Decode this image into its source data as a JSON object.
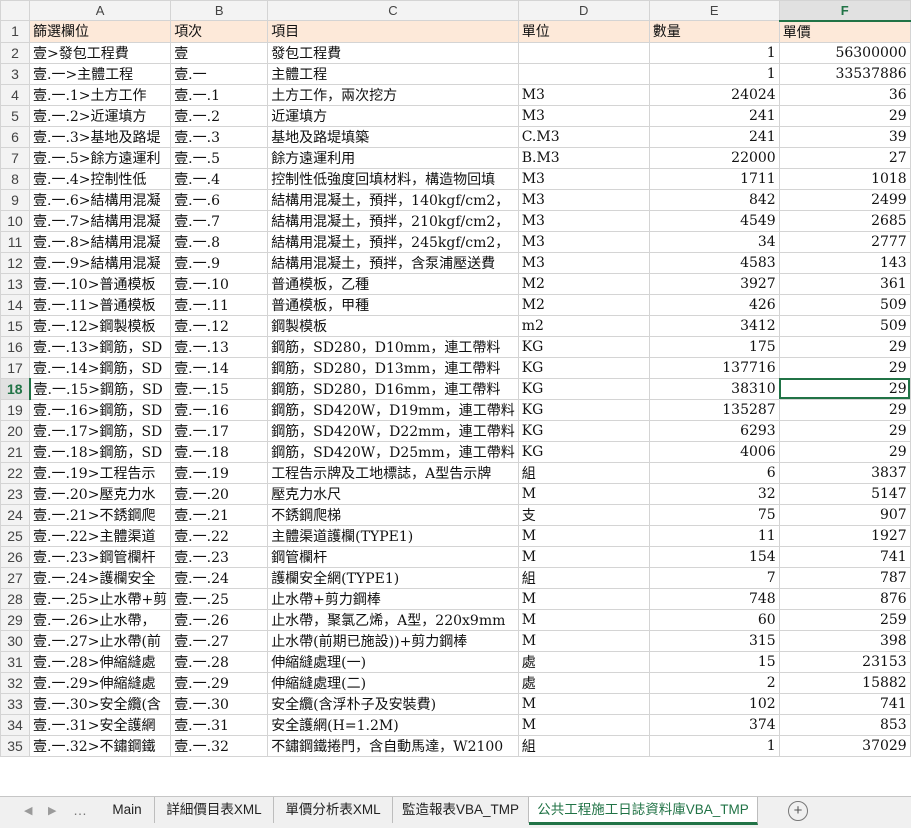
{
  "columns": [
    "A",
    "B",
    "C",
    "D",
    "E",
    "F"
  ],
  "rows": [
    {
      "n": "1",
      "a": "篩選欄位",
      "b": "項次",
      "c": "項目",
      "d": "單位",
      "e": "數量",
      "f": "單價"
    },
    {
      "n": "2",
      "a": "壹>發包工程費",
      "b": "壹",
      "c": "發包工程費",
      "d": "",
      "e": "1",
      "f": "56300000"
    },
    {
      "n": "3",
      "a": "壹.一>主體工程",
      "b": "壹.一",
      "c": "主體工程",
      "d": "",
      "e": "1",
      "f": "33537886"
    },
    {
      "n": "4",
      "a": "壹.一.1>土方工作",
      "b": "壹.一.1",
      "c": "土方工作，兩次挖方",
      "d": "M3",
      "e": "24024",
      "f": "36"
    },
    {
      "n": "5",
      "a": "壹.一.2>近運填方",
      "b": "壹.一.2",
      "c": "近運填方",
      "d": "M3",
      "e": "241",
      "f": "29"
    },
    {
      "n": "6",
      "a": "壹.一.3>基地及路堤",
      "b": "壹.一.3",
      "c": "基地及路堤填築",
      "d": "C.M3",
      "e": "241",
      "f": "39"
    },
    {
      "n": "7",
      "a": "壹.一.5>餘方遠運利",
      "b": "壹.一.5",
      "c": "餘方遠運利用",
      "d": "B.M3",
      "e": "22000",
      "f": "27"
    },
    {
      "n": "8",
      "a": "壹.一.4>控制性低",
      "b": "壹.一.4",
      "c": "控制性低強度回填材料，構造物回填",
      "d": "M3",
      "e": "1711",
      "f": "1018"
    },
    {
      "n": "9",
      "a": "壹.一.6>結構用混凝",
      "b": "壹.一.6",
      "c": "結構用混凝土，預拌，140kgf/cm2，",
      "d": "M3",
      "e": "842",
      "f": "2499"
    },
    {
      "n": "10",
      "a": "壹.一.7>結構用混凝",
      "b": "壹.一.7",
      "c": "結構用混凝土，預拌，210kgf/cm2，",
      "d": "M3",
      "e": "4549",
      "f": "2685"
    },
    {
      "n": "11",
      "a": "壹.一.8>結構用混凝",
      "b": "壹.一.8",
      "c": "結構用混凝土，預拌，245kgf/cm2，",
      "d": "M3",
      "e": "34",
      "f": "2777"
    },
    {
      "n": "12",
      "a": "壹.一.9>結構用混凝",
      "b": "壹.一.9",
      "c": "結構用混凝土，預拌，含泵浦壓送費",
      "d": "M3",
      "e": "4583",
      "f": "143"
    },
    {
      "n": "13",
      "a": "壹.一.10>普通模板",
      "b": "壹.一.10",
      "c": "普通模板，乙種",
      "d": "M2",
      "e": "3927",
      "f": "361"
    },
    {
      "n": "14",
      "a": "壹.一.11>普通模板",
      "b": "壹.一.11",
      "c": "普通模板，甲種",
      "d": "M2",
      "e": "426",
      "f": "509"
    },
    {
      "n": "15",
      "a": "壹.一.12>鋼製模板",
      "b": "壹.一.12",
      "c": "鋼製模板",
      "d": "m2",
      "e": "3412",
      "f": "509"
    },
    {
      "n": "16",
      "a": "壹.一.13>鋼筋，SD",
      "b": "壹.一.13",
      "c": "鋼筋，SD280，D10mm，連工帶料",
      "d": "KG",
      "e": "175",
      "f": "29"
    },
    {
      "n": "17",
      "a": "壹.一.14>鋼筋，SD",
      "b": "壹.一.14",
      "c": "鋼筋，SD280，D13mm，連工帶料",
      "d": "KG",
      "e": "137716",
      "f": "29"
    },
    {
      "n": "18",
      "a": "壹.一.15>鋼筋，SD",
      "b": "壹.一.15",
      "c": "鋼筋，SD280，D16mm，連工帶料",
      "d": "KG",
      "e": "38310",
      "f": "29"
    },
    {
      "n": "19",
      "a": "壹.一.16>鋼筋，SD",
      "b": "壹.一.16",
      "c": "鋼筋，SD420W，D19mm，連工帶料",
      "d": "KG",
      "e": "135287",
      "f": "29"
    },
    {
      "n": "20",
      "a": "壹.一.17>鋼筋，SD",
      "b": "壹.一.17",
      "c": "鋼筋，SD420W，D22mm，連工帶料",
      "d": "KG",
      "e": "6293",
      "f": "29"
    },
    {
      "n": "21",
      "a": "壹.一.18>鋼筋，SD",
      "b": "壹.一.18",
      "c": "鋼筋，SD420W，D25mm，連工帶料",
      "d": "KG",
      "e": "4006",
      "f": "29"
    },
    {
      "n": "22",
      "a": "壹.一.19>工程告示",
      "b": "壹.一.19",
      "c": "工程告示牌及工地標誌，A型告示牌",
      "d": "組",
      "e": "6",
      "f": "3837"
    },
    {
      "n": "23",
      "a": "壹.一.20>壓克力水",
      "b": "壹.一.20",
      "c": "壓克力水尺",
      "d": "M",
      "e": "32",
      "f": "5147"
    },
    {
      "n": "24",
      "a": "壹.一.21>不銹鋼爬",
      "b": "壹.一.21",
      "c": "不銹鋼爬梯",
      "d": "支",
      "e": "75",
      "f": "907"
    },
    {
      "n": "25",
      "a": "壹.一.22>主體渠道",
      "b": "壹.一.22",
      "c": "主體渠道護欄(TYPE1)",
      "d": "M",
      "e": "11",
      "f": "1927"
    },
    {
      "n": "26",
      "a": "壹.一.23>鋼管欄杆",
      "b": "壹.一.23",
      "c": "鋼管欄杆",
      "d": "M",
      "e": "154",
      "f": "741"
    },
    {
      "n": "27",
      "a": "壹.一.24>護欄安全",
      "b": "壹.一.24",
      "c": "護欄安全網(TYPE1)",
      "d": "組",
      "e": "7",
      "f": "787"
    },
    {
      "n": "28",
      "a": "壹.一.25>止水帶+剪",
      "b": "壹.一.25",
      "c": "止水帶+剪力鋼棒",
      "d": "M",
      "e": "748",
      "f": "876"
    },
    {
      "n": "29",
      "a": "壹.一.26>止水帶，",
      "b": "壹.一.26",
      "c": "止水帶，聚氯乙烯，A型，220x9mm",
      "d": "M",
      "e": "60",
      "f": "259"
    },
    {
      "n": "30",
      "a": "壹.一.27>止水帶(前",
      "b": "壹.一.27",
      "c": "止水帶(前期已施設))+剪力鋼棒",
      "d": "M",
      "e": "315",
      "f": "398"
    },
    {
      "n": "31",
      "a": "壹.一.28>伸縮縫處",
      "b": "壹.一.28",
      "c": "伸縮縫處理(一)",
      "d": "處",
      "e": "15",
      "f": "23153"
    },
    {
      "n": "32",
      "a": "壹.一.29>伸縮縫處",
      "b": "壹.一.29",
      "c": "伸縮縫處理(二)",
      "d": "處",
      "e": "2",
      "f": "15882"
    },
    {
      "n": "33",
      "a": "壹.一.30>安全纜(含",
      "b": "壹.一.30",
      "c": "安全纜(含浮朴子及安裝費)",
      "d": "M",
      "e": "102",
      "f": "741"
    },
    {
      "n": "34",
      "a": "壹.一.31>安全護網",
      "b": "壹.一.31",
      "c": "安全護網(H=1.2M)",
      "d": "M",
      "e": "374",
      "f": "853"
    },
    {
      "n": "35",
      "a": "壹.一.32>不鏽鋼鐵",
      "b": "壹.一.32",
      "c": "不鏽鋼鐵捲門，含自動馬達，W2100",
      "d": "組",
      "e": "1",
      "f": "37029"
    }
  ],
  "sheets": {
    "nav_left": "◀",
    "nav_right": "▶",
    "more": "…",
    "tabs": [
      "Main",
      "詳細價目表XML",
      "單價分析表XML",
      "監造報表VBA_TMP",
      "公共工程施工日誌資料庫VBA_TMP"
    ],
    "add": "+"
  },
  "selection": {
    "row": "18",
    "column": "F"
  },
  "colors": {
    "accent": "#217346",
    "header_fill": "#fde9d9"
  }
}
